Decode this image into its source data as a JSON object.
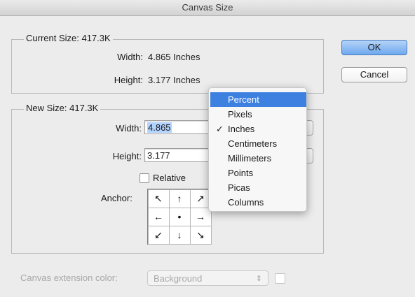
{
  "window": {
    "title": "Canvas Size"
  },
  "current": {
    "legend": "Current Size: 417.3K",
    "width_label": "Width:",
    "width_value": "4.865 Inches",
    "height_label": "Height:",
    "height_value": "3.177 Inches"
  },
  "new_size": {
    "legend": "New Size: 417.3K",
    "width_label": "Width:",
    "width_value": "4.865",
    "height_label": "Height:",
    "height_value": "3.177",
    "relative_label": "Relative",
    "anchor_label": "Anchor:"
  },
  "anchor_cells": [
    "↖",
    "↑",
    "↗",
    "←",
    "•",
    "→",
    "↙",
    "↓",
    "↘"
  ],
  "buttons": {
    "ok": "OK",
    "cancel": "Cancel"
  },
  "unit_menu": {
    "options": [
      "Percent",
      "Pixels",
      "Inches",
      "Centimeters",
      "Millimeters",
      "Points",
      "Picas",
      "Columns"
    ],
    "highlighted": "Percent",
    "checked": "Inches",
    "checkmark": "✓"
  },
  "extension": {
    "label": "Canvas extension color:",
    "value": "Background",
    "arrows": "⇕"
  }
}
